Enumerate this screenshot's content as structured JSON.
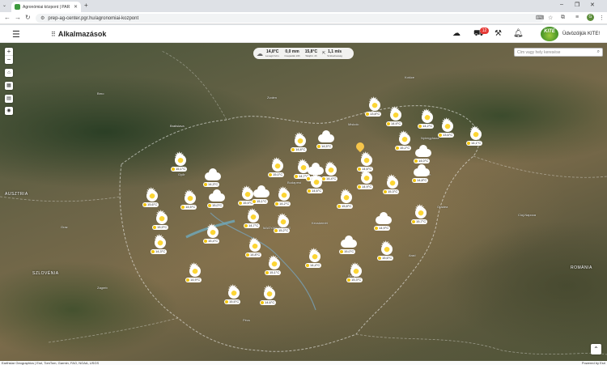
{
  "browser": {
    "tab_title": "Agronómiai központ | PAR",
    "url": "prep-ag-center.pgr.hu/agronomiai-kozpont",
    "profile_initial": "G"
  },
  "header": {
    "apps_label": "Alkalmazások",
    "cart_badge": "12",
    "greeting": "Üdvözöljük KITE!",
    "logo_text": "KITE"
  },
  "weather_summary": {
    "items": [
      {
        "value": "14,8°C",
        "label": "Levegő hőm."
      },
      {
        "value": "0,0 mm",
        "label": "Csapadék 24h"
      },
      {
        "value": "15,8°C",
        "label": "Talajhő. 4h"
      },
      {
        "value": "1,1 m/s",
        "label": "Szélsebesség"
      }
    ]
  },
  "search": {
    "placeholder": "Cím vagy hely keresése"
  },
  "map": {
    "countries": [
      {
        "name": "AUSZTRIA"
      },
      {
        "name": "SZLOVÉNIA"
      },
      {
        "name": "ROMÁNIA"
      }
    ],
    "places": [
      "Bratislava",
      "Brno",
      "Zvolen",
      "Košice",
      "Miskolc",
      "Debrecen",
      "Budapest",
      "Szeged",
      "Pécs",
      "Oradea",
      "Cluj-Napoca",
      "Zagreb",
      "Graz",
      "Győr",
      "Kecskemét",
      "MAGYARORSZÁG",
      "Nyíregyháza",
      "Arad"
    ],
    "markers": [
      {
        "type": "sun",
        "temp": "13,8°C"
      },
      {
        "type": "sun",
        "temp": "14,9°C"
      },
      {
        "type": "sun",
        "temp": "14,2°C"
      },
      {
        "type": "sun",
        "temp": "13,6°C"
      },
      {
        "type": "sun",
        "temp": "14,1°C"
      },
      {
        "type": "cloud",
        "temp": "14,5°C"
      },
      {
        "type": "sun",
        "temp": "14,8°C"
      },
      {
        "type": "sun",
        "temp": "15,2°C"
      },
      {
        "type": "cloud",
        "temp": "14,0°C"
      },
      {
        "type": "sun",
        "temp": "14,6°C"
      },
      {
        "type": "sun",
        "temp": "15,1°C"
      },
      {
        "type": "cloud",
        "temp": "14,3°C"
      },
      {
        "type": "sun",
        "temp": "15,0°C"
      },
      {
        "type": "sun",
        "temp": "14,7°C"
      },
      {
        "type": "cloud",
        "temp": "15,4°C"
      },
      {
        "type": "sun",
        "temp": "14,4°C"
      },
      {
        "type": "sun",
        "temp": "14,9°C"
      },
      {
        "type": "sun",
        "temp": "15,3°C"
      },
      {
        "type": "cloud",
        "temp": "14,8°C"
      },
      {
        "type": "sun",
        "temp": "15,6°C"
      },
      {
        "type": "sun",
        "temp": "14,5°C"
      },
      {
        "type": "cloud",
        "temp": "15,0°C"
      },
      {
        "type": "sun",
        "temp": "15,5°C"
      },
      {
        "type": "sun",
        "temp": "14,2°C"
      },
      {
        "type": "sun",
        "temp": "15,8°C"
      },
      {
        "type": "sun",
        "temp": "14,6°C"
      },
      {
        "type": "cloud",
        "temp": "15,1°C"
      },
      {
        "type": "sun",
        "temp": "15,9°C"
      },
      {
        "type": "sun",
        "temp": "14,7°C"
      },
      {
        "type": "sun",
        "temp": "15,2°C"
      },
      {
        "type": "cloud",
        "temp": "14,9°C"
      },
      {
        "type": "sun",
        "temp": "15,7°C"
      },
      {
        "type": "sun",
        "temp": "15,4°C"
      },
      {
        "type": "sun",
        "temp": "14,3°C"
      },
      {
        "type": "cloud",
        "temp": "15,0°C"
      },
      {
        "type": "sun",
        "temp": "15,6°C"
      },
      {
        "type": "sun",
        "temp": "14,8°C"
      },
      {
        "type": "sun",
        "temp": "15,1°C"
      },
      {
        "type": "sun",
        "temp": "14,4°C"
      },
      {
        "type": "sun",
        "temp": "15,3°C"
      },
      {
        "type": "sun",
        "temp": "14,9°C"
      },
      {
        "type": "sun",
        "temp": "15,5°C"
      },
      {
        "type": "sun",
        "temp": "14,6°C"
      }
    ]
  },
  "attribution": {
    "left": "Earthstar Geographics | Esri, TomTom, Garmin, FAO, NOAA, USGS",
    "right": "Powered by Esri"
  }
}
